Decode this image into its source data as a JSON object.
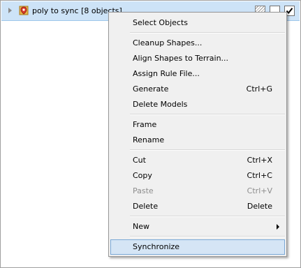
{
  "tree": {
    "row_label": "poly to sync [8 objects]",
    "icons": [
      "expand-arrow-icon",
      "layer-icon",
      "hatch-icon",
      "checkbox-icon",
      "checkmark-icon"
    ]
  },
  "menu": {
    "items": [
      {
        "label": "Select Objects",
        "shortcut": ""
      },
      {
        "label": "Cleanup Shapes...",
        "shortcut": ""
      },
      {
        "label": "Align Shapes to Terrain...",
        "shortcut": ""
      },
      {
        "label": "Assign Rule File...",
        "shortcut": ""
      },
      {
        "label": "Generate",
        "shortcut": "Ctrl+G"
      },
      {
        "label": "Delete Models",
        "shortcut": ""
      },
      {
        "label": "Frame",
        "shortcut": ""
      },
      {
        "label": "Rename",
        "shortcut": ""
      },
      {
        "label": "Cut",
        "shortcut": "Ctrl+X"
      },
      {
        "label": "Copy",
        "shortcut": "Ctrl+C"
      },
      {
        "label": "Paste",
        "shortcut": "Ctrl+V",
        "disabled": true
      },
      {
        "label": "Delete",
        "shortcut": "Delete"
      },
      {
        "label": "New",
        "shortcut": "",
        "submenu": true
      },
      {
        "label": "Synchronize",
        "shortcut": "",
        "highlighted": true
      }
    ]
  },
  "colors": {
    "row_selection": "#cde3f7",
    "menu_background": "#f0f0f0",
    "menu_highlight": "#d5e5f5",
    "disabled_text": "#8d8d8d"
  }
}
